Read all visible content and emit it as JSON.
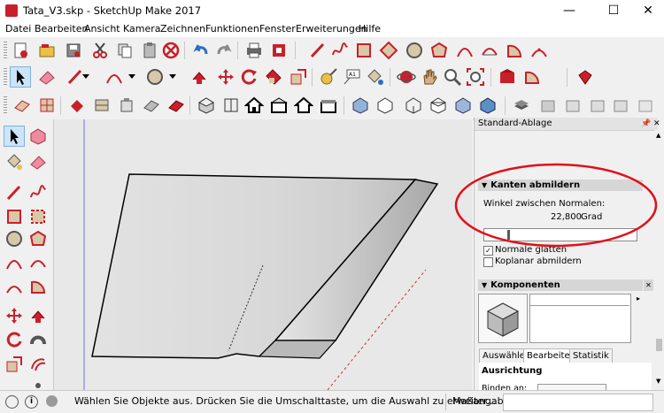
{
  "window": {
    "title": "Tata_V3.skp - SketchUp Make 2017",
    "minimize_glyph": "—",
    "maximize_glyph": "☐",
    "close_glyph": "✕"
  },
  "menu": {
    "items": [
      "Datei",
      "Bearbeiten",
      "Ansicht",
      "Kamera",
      "Zeichnen",
      "Funktionen",
      "Fenster",
      "Erweiterungen",
      "Hilfe"
    ]
  },
  "panel": {
    "title": "Standard-Ablage",
    "pin_glyph": "📌",
    "close_glyph": "✕",
    "soften": {
      "header": "Kanten abmildern",
      "angle_label": "Winkel zwischen Normalen:",
      "angle_value": "22,800",
      "angle_unit": "Grad",
      "slider_fraction": 0.152,
      "smooth_normals_label": "Normale glätten",
      "smooth_normals_checked": true,
      "soften_coplanar_label": "Koplanar abmildern",
      "soften_coplanar_checked": false
    },
    "components": {
      "header": "Komponenten",
      "tabs": [
        "Auswählen",
        "Bearbeiten",
        "Statistik"
      ],
      "active_tab": 1,
      "section_label": "Ausrichtung",
      "bind_label": "Binden an:"
    }
  },
  "status": {
    "hint": "Wählen Sie Objekte aus. Drücken Sie die Umschalttaste, um die Auswahl zu erweiter...",
    "measurements_label": "Maßangaben"
  },
  "colors": {
    "annotation_red": "#e0101a",
    "selected_tool": "#cce4f7",
    "ui_background": "#f0f0f0"
  }
}
